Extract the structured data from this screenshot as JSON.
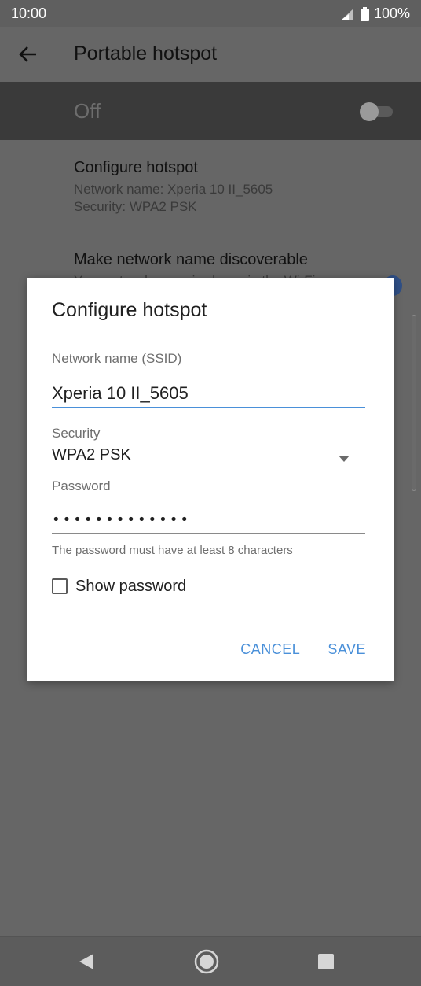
{
  "status_bar": {
    "time": "10:00",
    "battery": "100%",
    "icons": [
      "signal-icon",
      "battery-icon"
    ]
  },
  "app_bar": {
    "title": "Portable hotspot",
    "back_icon": "back-arrow-icon"
  },
  "hotspot_toggle": {
    "label": "Off",
    "enabled": false
  },
  "settings": {
    "configure": {
      "title": "Configure hotspot",
      "network_line": "Network name: Xperia 10 II_5605",
      "security_line": "Security: WPA2 PSK"
    },
    "discoverable": {
      "title": "Make network name discoverable",
      "subtitle": "Your network name is shown in the Wi-Fi"
    }
  },
  "dialog": {
    "title": "Configure hotspot",
    "ssid_label": "Network name (SSID)",
    "ssid_value": "Xperia 10 II_5605",
    "security_label": "Security",
    "security_value": "WPA2 PSK",
    "password_label": "Password",
    "password_value": "•••••••••••••",
    "password_hint": "The password must have at least 8 characters",
    "show_password_label": "Show password",
    "show_password_checked": false,
    "cancel_label": "CANCEL",
    "save_label": "SAVE"
  },
  "colors": {
    "accent": "#4a90d9",
    "scrim_background": "#666666",
    "toggle_row_background": "#3a3a3a"
  }
}
